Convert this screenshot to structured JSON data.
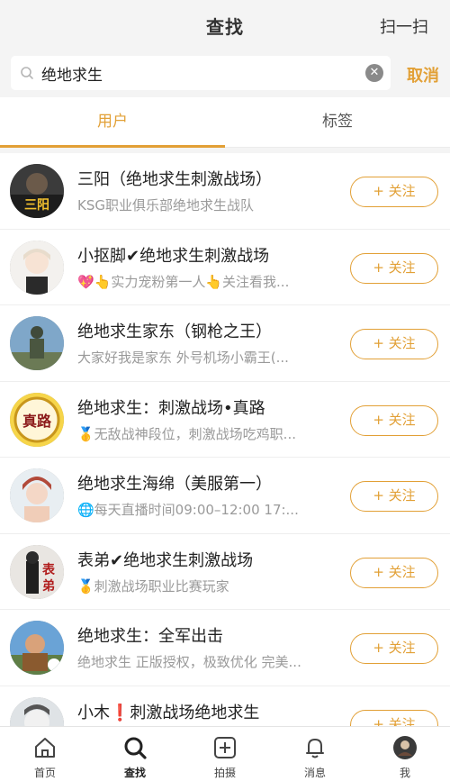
{
  "header": {
    "title": "查找",
    "scan_label": "扫一扫"
  },
  "search": {
    "value": "绝地求生",
    "clear_icon": "clear-icon",
    "cancel_label": "取消"
  },
  "tabs": [
    {
      "label": "用户",
      "active": true
    },
    {
      "label": "标签",
      "active": false
    }
  ],
  "accent_color": "#e2a036",
  "results": [
    {
      "name": "三阳（绝地求生刺激战场）",
      "desc": "KSG职业俱乐部绝地求生战队",
      "follow_label": "+ 关注"
    },
    {
      "name": "小抠脚✔绝地求生刺激战场",
      "desc": "💖👆实力宠粉第一人👆关注看我...",
      "follow_label": "+ 关注"
    },
    {
      "name": "绝地求生家东（钢枪之王）",
      "desc": "大家好我是家东  外号机场小霸王(...",
      "follow_label": "+ 关注"
    },
    {
      "name": "绝地求生：刺激战场•真路",
      "desc": "🥇无敌战神段位，刺激战场吃鸡职...",
      "follow_label": "+ 关注"
    },
    {
      "name": "绝地求生海绵（美服第一）",
      "desc": "🌐每天直播时间09:00–12:00  17:...",
      "follow_label": "+ 关注"
    },
    {
      "name": "表弟✔绝地求生刺激战场",
      "desc": "🥇刺激战场职业比赛玩家",
      "follow_label": "+ 关注"
    },
    {
      "name": "绝地求生：全军出击",
      "desc": "绝地求生 正版授权，极致优化 完美...",
      "follow_label": "+ 关注"
    },
    {
      "name": "小木❗刺激战场绝地求生",
      "desc": "",
      "follow_label": "+ 关注"
    }
  ],
  "bottom_nav": [
    {
      "label": "首页",
      "icon": "home-icon"
    },
    {
      "label": "查找",
      "icon": "search-icon",
      "active": true
    },
    {
      "label": "拍摄",
      "icon": "camera-plus-icon"
    },
    {
      "label": "消息",
      "icon": "bell-icon"
    },
    {
      "label": "我",
      "icon": "profile-avatar"
    }
  ]
}
